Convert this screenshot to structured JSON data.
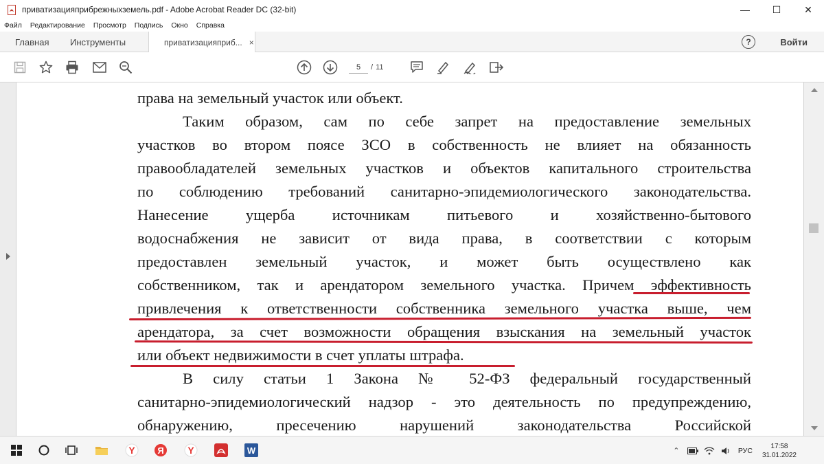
{
  "window": {
    "title": "приватизацияприбрежныхземель.pdf - Adobe Acrobat Reader DC (32-bit)",
    "minimize": "—",
    "maximize": "☐",
    "close": "✕"
  },
  "menu": [
    "Файл",
    "Редактирование",
    "Просмотр",
    "Подпись",
    "Окно",
    "Справка"
  ],
  "tabs": {
    "home": "Главная",
    "tools": "Инструменты",
    "document": "приватизацияприб...",
    "close_glyph": "×",
    "help": "?",
    "signin": "Войти"
  },
  "toolbar": {
    "icons": [
      "save-icon",
      "bookmark-star-icon",
      "print-icon",
      "email-icon",
      "search-zoom-icon",
      "page-up-icon",
      "page-down-icon",
      "comment-icon",
      "highlight-pen-icon",
      "fill-sign-icon",
      "more-tools-icon"
    ],
    "page_current": "5",
    "page_separator": "/",
    "page_total": "11"
  },
  "document": {
    "lines": [
      "права на земельный участок или объект.",
      "Таким образом, сам по себе запрет на предоставление земельных",
      "участков во втором поясе ЗСО в собственность не влияет на обязанность",
      "правообладателей земельных участков и объектов капитального строительства",
      "по соблюдению требований санитарно-эпидемиологического законодательства.",
      "Нанесение ущерба источникам питьевого и хозяйственно-бытового",
      "водоснабжения не зависит от вида права, в соответствии с которым",
      "предоставлен земельный участок, и может быть осуществлено как",
      "собственником, так и арендатором земельного участка. Причем эффективность",
      "привлечения к ответственности собственника земельного участка выше, чем",
      "арендатора, за счет возможности обращения взыскания на земельный участок",
      "или объект недвижимости в счет уплаты штрафа.",
      "В силу статьи 1 Закона № 52-ФЗ федеральный государственный",
      "санитарно-эпидемиологический надзор - это деятельность по предупреждению,",
      "обнаружению, пресечению нарушений законодательства Российской"
    ],
    "highlight_color": "#c81e2e"
  },
  "taskbar": {
    "apps": [
      "windows-start-icon",
      "cortana-circle-icon",
      "task-view-icon",
      "file-explorer-icon",
      "yandex-browser-icon",
      "yandex-icon",
      "yandex-browser-2-icon",
      "acrobat-reader-icon",
      "word-icon"
    ],
    "language": "РУС",
    "time": "17:58",
    "date": "31.01.2022"
  }
}
